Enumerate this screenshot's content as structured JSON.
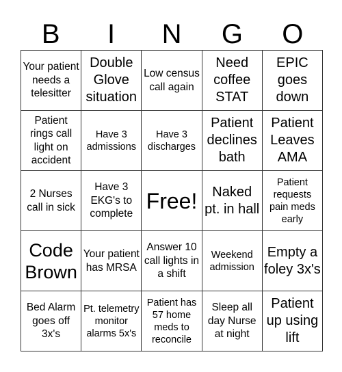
{
  "header": [
    "B",
    "I",
    "N",
    "G",
    "O"
  ],
  "cells": [
    [
      {
        "text": "Your patient needs a telesitter",
        "size": "s15"
      },
      {
        "text": "Double Glove situation",
        "size": "s20"
      },
      {
        "text": "Low census call again",
        "size": "s15"
      },
      {
        "text": "Need coffee STAT",
        "size": "s20"
      },
      {
        "text": "EPIC goes down",
        "size": "s20"
      }
    ],
    [
      {
        "text": "Patient rings call light on accident",
        "size": "s15"
      },
      {
        "text": "Have 3 admissions",
        "size": "s14"
      },
      {
        "text": "Have 3 discharges",
        "size": "s14"
      },
      {
        "text": "Patient declines bath",
        "size": "s20"
      },
      {
        "text": "Patient Leaves AMA",
        "size": "s20"
      }
    ],
    [
      {
        "text": "2 Nurses call in sick",
        "size": "s15"
      },
      {
        "text": "Have 3 EKG's to complete",
        "size": "s15"
      },
      {
        "text": "Free!",
        "size": "s32"
      },
      {
        "text": "Naked pt. in hall",
        "size": "s20"
      },
      {
        "text": "Patient requests pain meds early",
        "size": "s14"
      }
    ],
    [
      {
        "text": "Code Brown",
        "size": "s26"
      },
      {
        "text": "Your patient has MRSA",
        "size": "s15"
      },
      {
        "text": "Answer 10 call lights in a shift",
        "size": "s15"
      },
      {
        "text": "Weekend admission",
        "size": "s14"
      },
      {
        "text": "Empty a foley 3x's",
        "size": "s20"
      }
    ],
    [
      {
        "text": "Bed Alarm goes off 3x's",
        "size": "s15"
      },
      {
        "text": "Pt. telemetry monitor alarms 5x's",
        "size": "s14"
      },
      {
        "text": "Patient has 57 home meds to reconcile",
        "size": "s14"
      },
      {
        "text": "Sleep all day Nurse at night",
        "size": "s15"
      },
      {
        "text": "Patient up using lift",
        "size": "s20"
      }
    ]
  ]
}
